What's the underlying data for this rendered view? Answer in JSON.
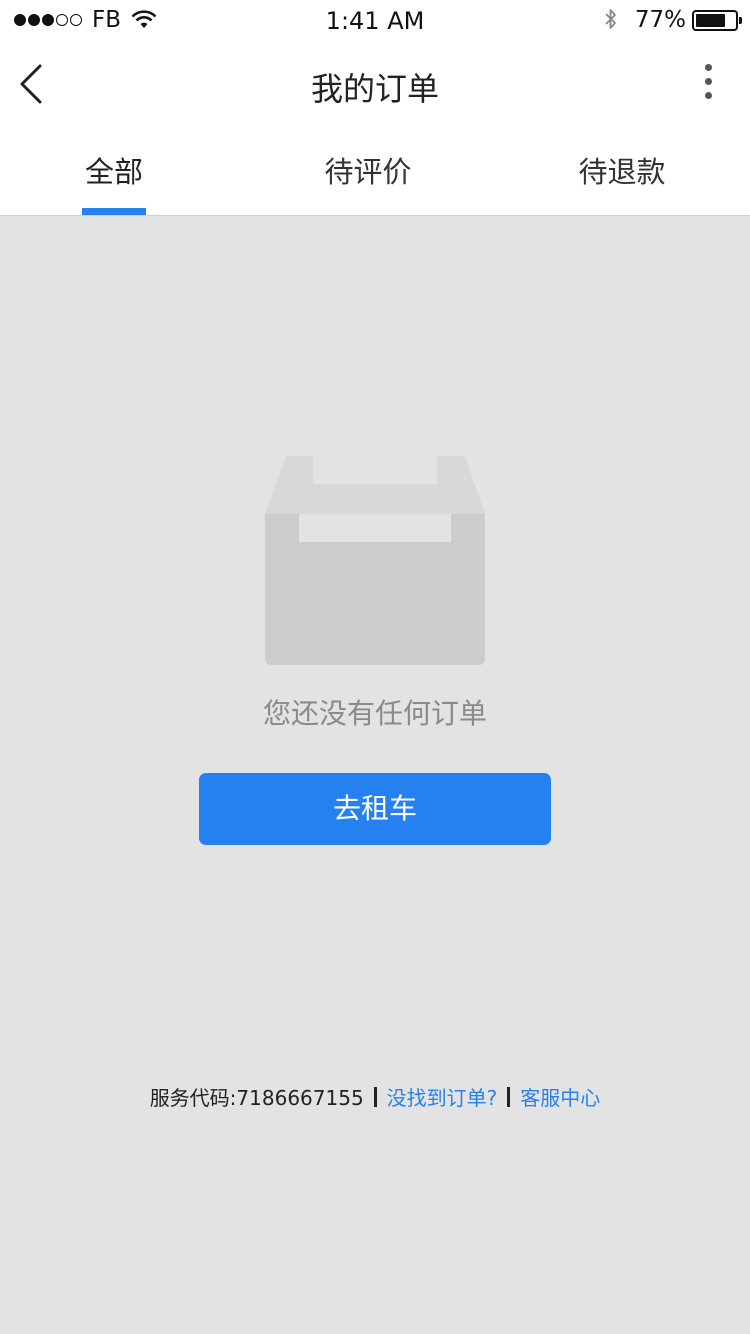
{
  "status_bar": {
    "carrier": "FB",
    "time": "1:41 AM",
    "battery_percent": "77%",
    "battery_level": 0.77,
    "signal_bars_filled": 3,
    "signal_bars_total": 5,
    "icons": [
      "wifi-icon",
      "bluetooth-icon",
      "battery-icon"
    ]
  },
  "nav": {
    "title": "我的订单",
    "back_icon": "chevron-left-icon",
    "more_icon": "more-vertical-icon"
  },
  "tabs": [
    {
      "label": "全部",
      "active": true
    },
    {
      "label": "待评价",
      "active": false
    },
    {
      "label": "待退款",
      "active": false
    }
  ],
  "empty_state": {
    "icon": "empty-box-icon",
    "message": "您还没有任何订单",
    "button_label": "去租车"
  },
  "footer": {
    "service_code": "服务代码:7186667155",
    "link_not_found": "没找到订单?",
    "link_support": "客服中心"
  },
  "colors": {
    "accent": "#2581f0",
    "background": "#e3e3e3",
    "surface": "#ffffff",
    "empty_text": "#8a8a8a"
  }
}
